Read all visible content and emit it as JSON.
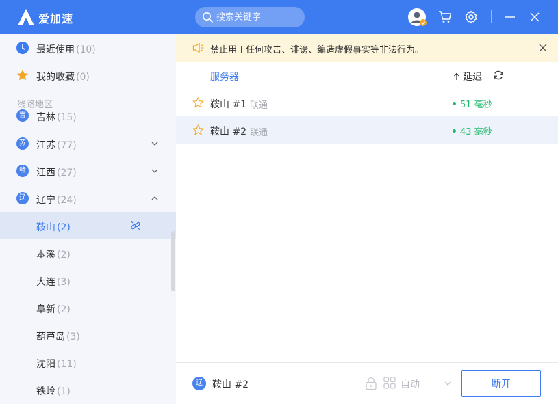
{
  "app": {
    "title": "爱加速"
  },
  "search": {
    "placeholder": "搜索关键字"
  },
  "colors": {
    "accent": "#3d7cf0",
    "ping_good": "#20b96a",
    "notice_bg": "#fdf5dc"
  },
  "sidebar": {
    "recent": {
      "label": "最近使用",
      "count": "(10)"
    },
    "favorites": {
      "label": "我的收藏",
      "count": "(0)"
    },
    "section_label": "线路地区",
    "provinces": [
      {
        "label": "吉林",
        "count": "(15)",
        "badge": "吉"
      },
      {
        "label": "江苏",
        "count": "(77)",
        "badge": "苏"
      },
      {
        "label": "江西",
        "count": "(27)",
        "badge": "赣"
      },
      {
        "label": "辽宁",
        "count": "(24)",
        "badge": "辽"
      }
    ],
    "cities": [
      {
        "label": "鞍山",
        "count": "(2)"
      },
      {
        "label": "本溪",
        "count": "(2)"
      },
      {
        "label": "大连",
        "count": "(3)"
      },
      {
        "label": "阜新",
        "count": "(2)"
      },
      {
        "label": "葫芦岛",
        "count": "(3)"
      },
      {
        "label": "沈阳",
        "count": "(11)"
      },
      {
        "label": "铁岭",
        "count": "(1)"
      }
    ]
  },
  "notice": {
    "text": "禁止用于任何攻击、诽谤、编造虚假事实等非法行为。"
  },
  "table": {
    "col_server": "服务器",
    "col_latency": "延迟",
    "rows": [
      {
        "name": "鞍山 #1",
        "isp": "联通",
        "ping": "51 毫秒"
      },
      {
        "name": "鞍山 #2",
        "isp": "联通",
        "ping": "43 毫秒"
      }
    ]
  },
  "footer": {
    "current_badge": "辽",
    "current_name": "鞍山 #2",
    "mode": "自动",
    "disconnect_label": "断开"
  }
}
